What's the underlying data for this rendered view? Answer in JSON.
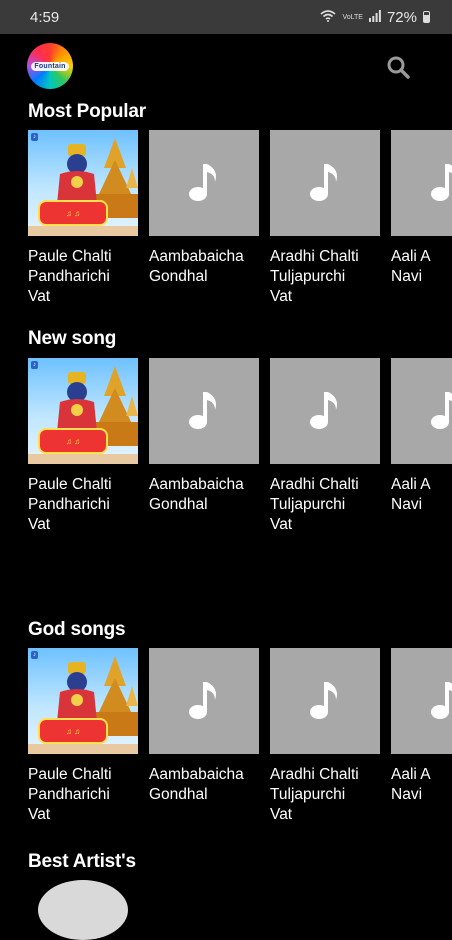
{
  "status": {
    "time": "4:59",
    "network": "VoLTE",
    "battery": "72%"
  },
  "app": {
    "logo_text": "Fountain",
    "search_icon": "search-icon"
  },
  "colors": {
    "background": "#000000",
    "placeholder": "#a8a8a8",
    "statusbar": "#3a3a3a"
  },
  "sections": [
    {
      "title": "Most Popular",
      "items": [
        {
          "title": "Paule Chalti\nPandharichi\nVat",
          "thumb": "album-art"
        },
        {
          "title": "Aambabaicha\nGondhal",
          "thumb": "music-note-icon"
        },
        {
          "title": "Aradhi Chalti\nTuljapurchi\nVat",
          "thumb": "music-note-icon"
        },
        {
          "title": "Aali A\nNavi",
          "thumb": "music-note-icon"
        }
      ]
    },
    {
      "title": "New song",
      "items": [
        {
          "title": "Paule Chalti\nPandharichi\nVat",
          "thumb": "album-art"
        },
        {
          "title": "Aambabaicha\nGondhal",
          "thumb": "music-note-icon"
        },
        {
          "title": "Aradhi Chalti\nTuljapurchi\nVat",
          "thumb": "music-note-icon"
        },
        {
          "title": "Aali A\nNavi",
          "thumb": "music-note-icon"
        }
      ]
    },
    {
      "title": "God songs",
      "items": [
        {
          "title": "Paule Chalti\nPandharichi\nVat",
          "thumb": "album-art"
        },
        {
          "title": "Aambabaicha\nGondhal",
          "thumb": "music-note-icon"
        },
        {
          "title": "Aradhi Chalti\nTuljapurchi\nVat",
          "thumb": "music-note-icon"
        },
        {
          "title": "Aali A\nNavi",
          "thumb": "music-note-icon"
        }
      ]
    },
    {
      "title": "Best Artist's",
      "items": []
    }
  ]
}
